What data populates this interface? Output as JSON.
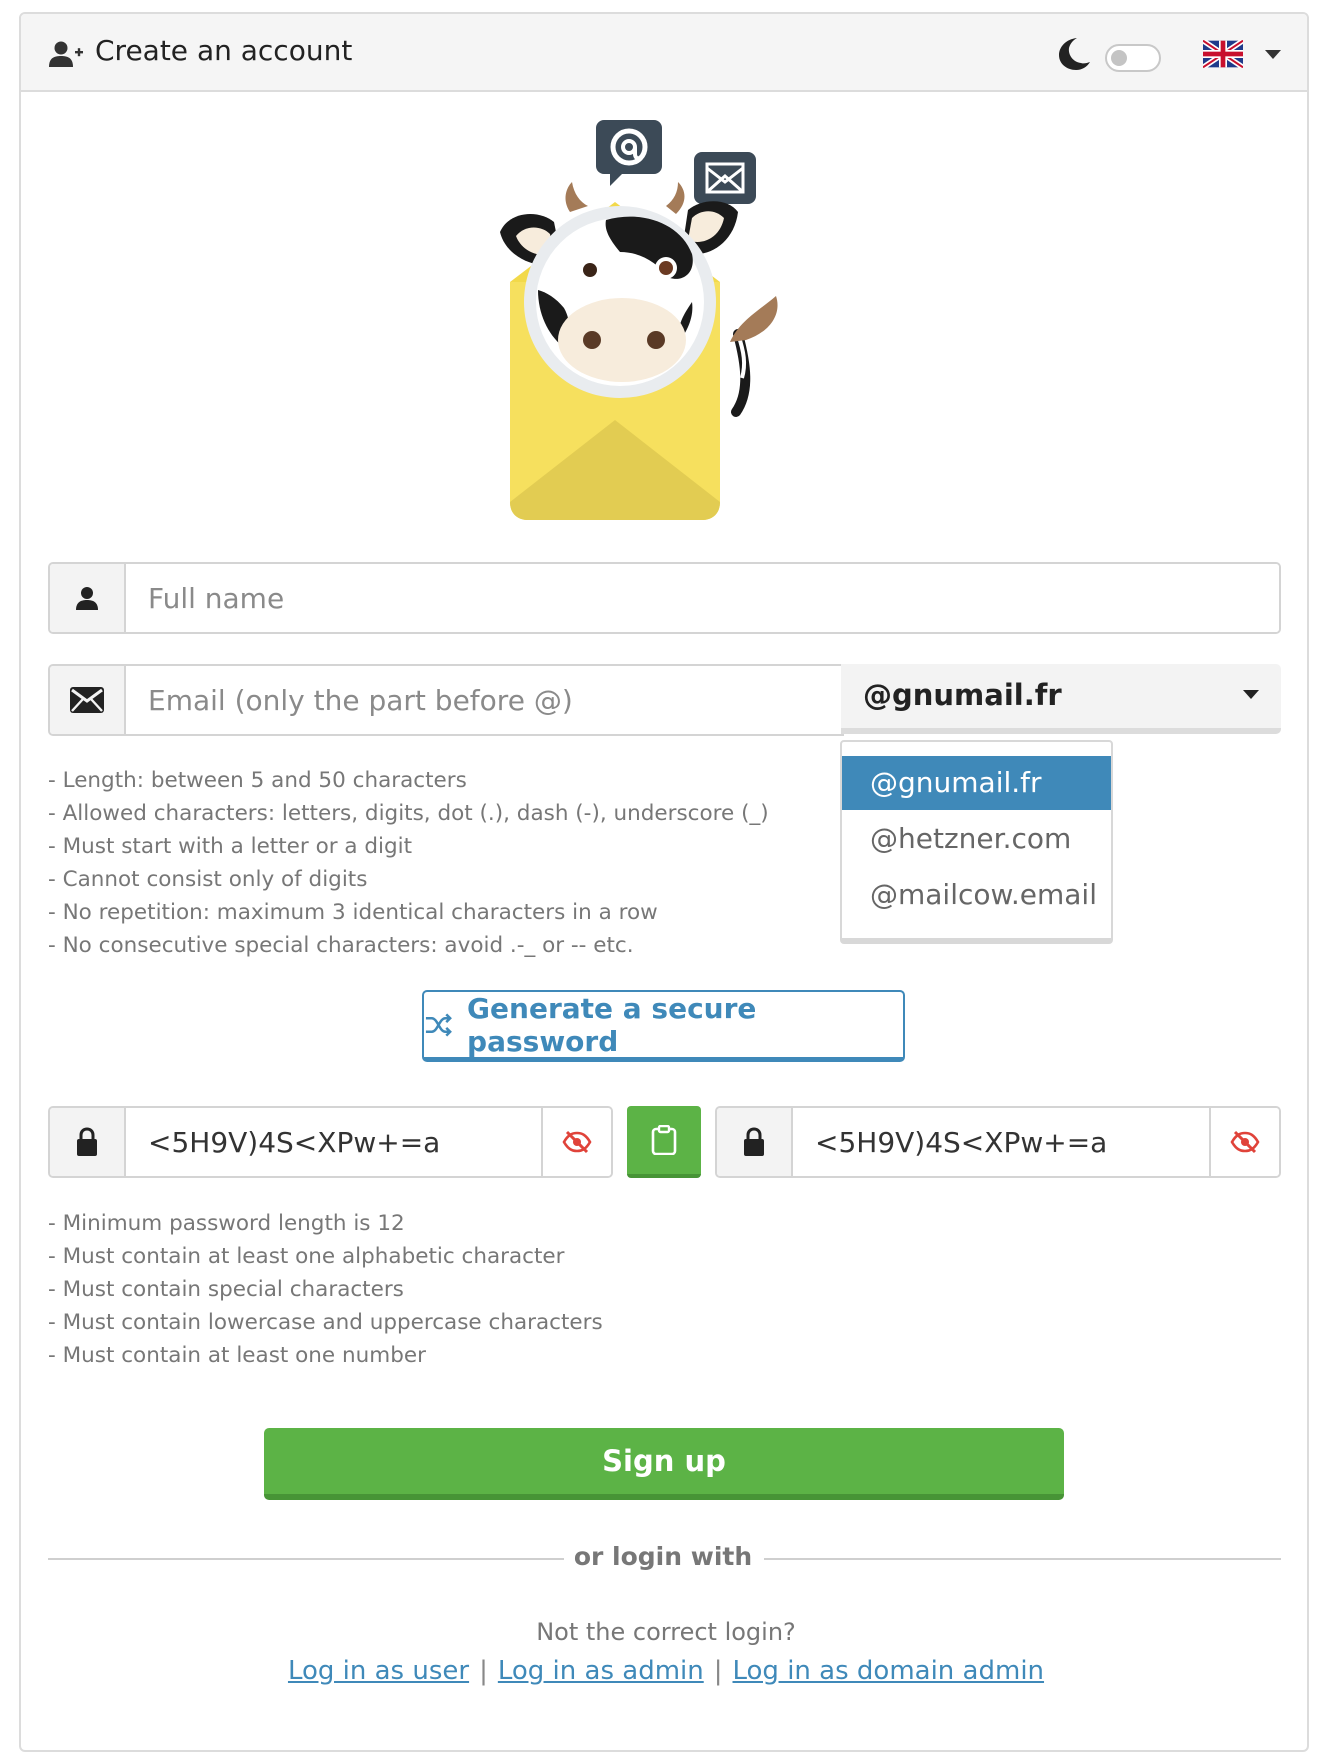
{
  "header": {
    "title": "Create an account",
    "icons": [
      "user-plus-icon",
      "moon-icon",
      "uk-flag-icon",
      "caret-down-icon"
    ],
    "dark_mode_enabled": false
  },
  "form": {
    "full_name": {
      "placeholder": "Full name",
      "value": ""
    },
    "email": {
      "placeholder": "Email (only the part before @)",
      "value": ""
    },
    "domain": {
      "selected": "@gnumail.fr",
      "options": [
        "@gnumail.fr",
        "@hetzner.com",
        "@mailcow.email"
      ]
    },
    "email_hints": [
      "- Length: between 5 and 50 characters",
      "- Allowed characters: letters, digits, dot (.), dash (-), underscore (_)",
      "- Must start with a letter or a digit",
      "- Cannot consist only of digits",
      "- No repetition: maximum 3 identical characters in a row",
      "- No consecutive special characters: avoid .-_ or -- etc."
    ],
    "generate_button": "Generate a secure password",
    "password": {
      "value": "<5H9V)4S<XPw+=a"
    },
    "password_confirm": {
      "value": "<5H9V)4S<XPw+=a"
    },
    "password_hints": [
      "- Minimum password length is 12",
      "- Must contain at least one alphabetic character",
      "- Must contain special characters",
      "- Must contain lowercase and uppercase characters",
      "- Must contain at least one number"
    ],
    "signup_button": "Sign up"
  },
  "login": {
    "divider": "or login with",
    "not_correct": "Not the correct login?",
    "links": [
      "Log in as user",
      "Log in as admin",
      "Log in as domain admin"
    ],
    "separator": "|"
  },
  "colors": {
    "accent": "#3f89b9",
    "success": "#5cb346",
    "danger": "#e0433a"
  }
}
